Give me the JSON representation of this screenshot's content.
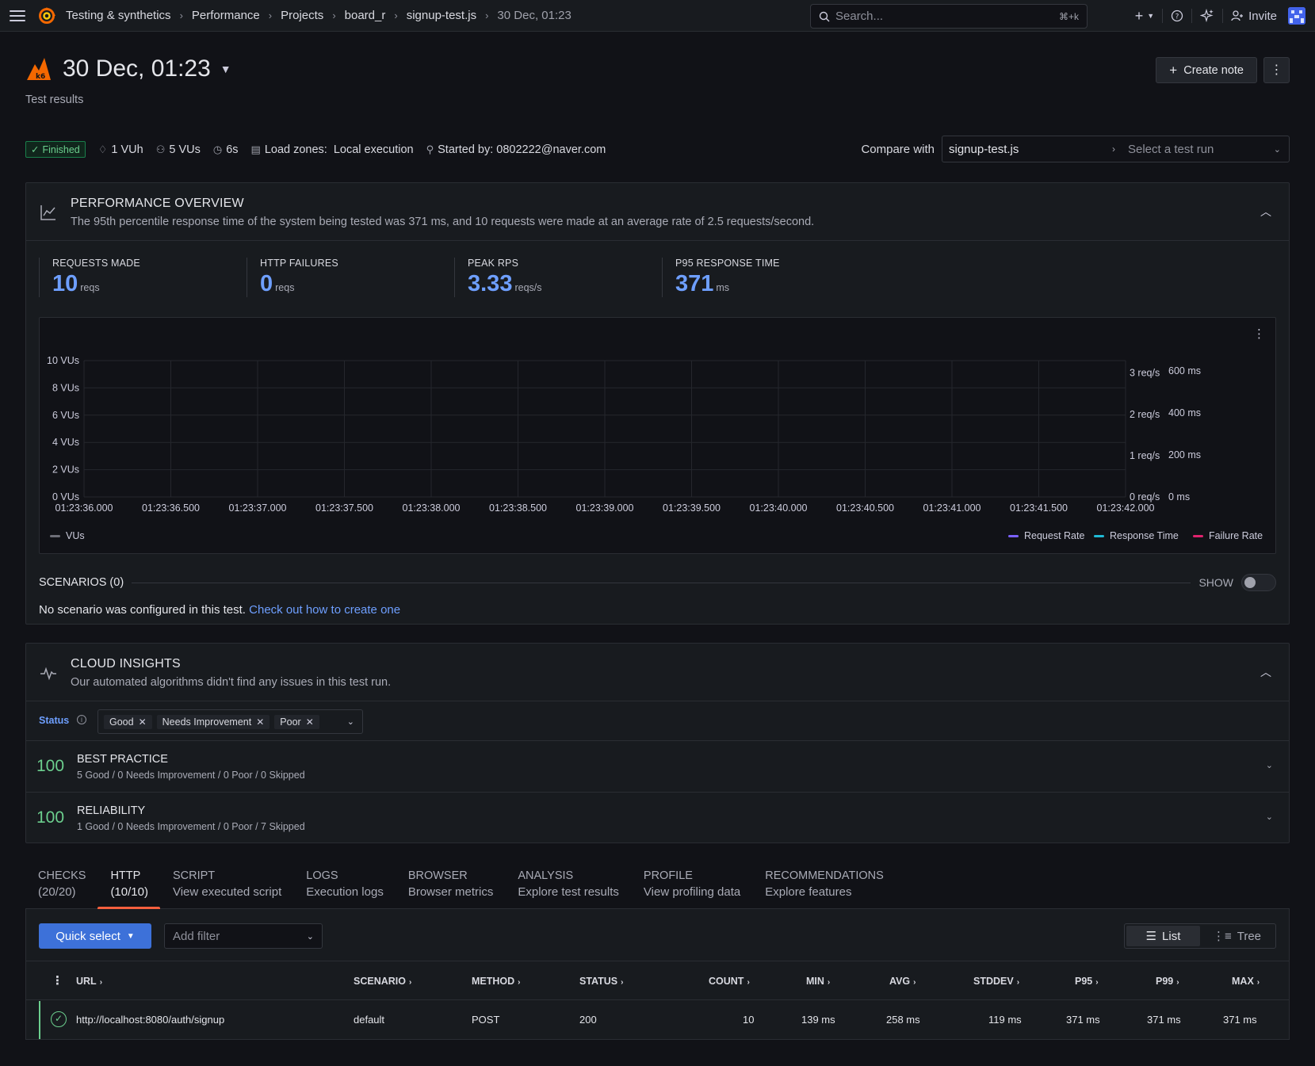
{
  "topbar": {
    "breadcrumbs": [
      "Testing & synthetics",
      "Performance",
      "Projects",
      "board_r",
      "signup-test.js",
      "30 Dec, 01:23"
    ],
    "search_placeholder": "Search...",
    "search_shortcut": "⌘+k",
    "add_label": "+",
    "invite_label": "Invite"
  },
  "header": {
    "title": "30 Dec, 01:23",
    "subtitle": "Test results",
    "create_note_label": "Create note"
  },
  "meta": {
    "status": "Finished",
    "vuh": "1 VUh",
    "vus": "5 VUs",
    "duration": "6s",
    "load_zones_label": "Load zones:",
    "load_zones_value": "Local execution",
    "started_by": "Started by: 0802222@naver.com"
  },
  "compare": {
    "label": "Compare with",
    "script": "signup-test.js",
    "run_placeholder": "Select a test run"
  },
  "performance": {
    "title": "PERFORMANCE OVERVIEW",
    "description": "The 95th percentile response time of the system being tested was 371 ms, and 10 requests were made at an average rate of 2.5 requests/second.",
    "stats": [
      {
        "label": "REQUESTS MADE",
        "value": "10",
        "unit": "reqs"
      },
      {
        "label": "HTTP FAILURES",
        "value": "0",
        "unit": "reqs"
      },
      {
        "label": "PEAK RPS",
        "value": "3.33",
        "unit": "reqs/s"
      },
      {
        "label": "P95 RESPONSE TIME",
        "value": "371",
        "unit": "ms"
      }
    ]
  },
  "chart_data": {
    "type": "line",
    "x": [
      "01:23:36.000",
      "01:23:36.500",
      "01:23:37.000",
      "01:23:37.500",
      "01:23:38.000",
      "01:23:38.500",
      "01:23:39.000",
      "01:23:39.500",
      "01:23:40.000",
      "01:23:40.500",
      "01:23:41.000",
      "01:23:41.500",
      "01:23:42.000"
    ],
    "y_left_ticks": [
      "10 VUs",
      "8 VUs",
      "6 VUs",
      "4 VUs",
      "2 VUs",
      "0 VUs"
    ],
    "y_left_range": [
      0,
      10
    ],
    "y_right_rate_ticks": [
      "3 req/s",
      "2 req/s",
      "1 req/s",
      "0 req/s"
    ],
    "y_right_rate_range": [
      0,
      3.3
    ],
    "y_right_time_ticks": [
      "600 ms",
      "400 ms",
      "200 ms",
      "0 ms"
    ],
    "y_right_time_range": [
      0,
      650
    ],
    "legend_left": [
      {
        "name": "VUs",
        "color": "#6e6f78"
      }
    ],
    "legend_right": [
      {
        "name": "Request Rate",
        "color": "#7b61ff"
      },
      {
        "name": "Response Time",
        "color": "#1fbad6"
      },
      {
        "name": "Failure Rate",
        "color": "#e0226e"
      }
    ],
    "series": [],
    "grid": true,
    "legend_placement": "bottom"
  },
  "scenarios": {
    "title": "SCENARIOS (0)",
    "show_label": "SHOW",
    "message": "No scenario was configured in this test.",
    "link": "Check out how to create one"
  },
  "insights": {
    "title": "CLOUD INSIGHTS",
    "description": "Our automated algorithms didn't find any issues in this test run.",
    "status_label": "Status",
    "chips": [
      "Good",
      "Needs Improvement",
      "Poor"
    ],
    "items": [
      {
        "score": "100",
        "title": "BEST PRACTICE",
        "summary": "5 Good / 0 Needs Improvement / 0 Poor / 0 Skipped"
      },
      {
        "score": "100",
        "title": "RELIABILITY",
        "summary": "1 Good / 0 Needs Improvement / 0 Poor / 7 Skipped"
      }
    ]
  },
  "tabs": [
    {
      "t1": "CHECKS",
      "t2": "(20/20)"
    },
    {
      "t1": "HTTP",
      "t2": "(10/10)"
    },
    {
      "t1": "SCRIPT",
      "t2": "View executed script"
    },
    {
      "t1": "LOGS",
      "t2": "Execution logs"
    },
    {
      "t1": "BROWSER",
      "t2": "Browser metrics"
    },
    {
      "t1": "ANALYSIS",
      "t2": "Explore test results"
    },
    {
      "t1": "PROFILE",
      "t2": "View profiling data"
    },
    {
      "t1": "RECOMMENDATIONS",
      "t2": "Explore features"
    }
  ],
  "http": {
    "quick_select": "Quick select",
    "add_filter": "Add filter",
    "view_list": "List",
    "view_tree": "Tree",
    "columns": [
      "URL",
      "SCENARIO",
      "METHOD",
      "STATUS",
      "COUNT",
      "MIN",
      "AVG",
      "STDDEV",
      "P95",
      "P99",
      "MAX"
    ],
    "rows": [
      {
        "url": "http://localhost:8080/auth/signup",
        "scenario": "default",
        "method": "POST",
        "status": "200",
        "count": "10",
        "min": "139 ms",
        "avg": "258 ms",
        "stddev": "119 ms",
        "p95": "371 ms",
        "p99": "371 ms",
        "max": "371 ms"
      }
    ]
  }
}
